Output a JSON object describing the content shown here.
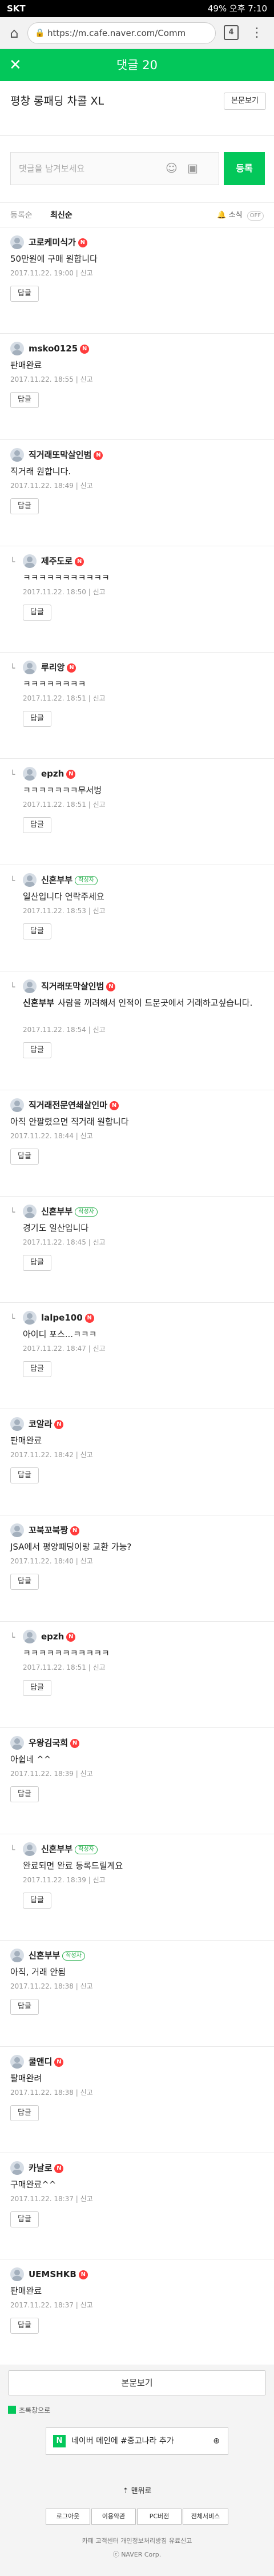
{
  "status_bar": {
    "carrier": "SKT",
    "right": "49% 오후 7:10"
  },
  "browser": {
    "url": "https://m.cafe.naver.com/Comm",
    "tab_count": "4"
  },
  "header": {
    "title": "댓글 20"
  },
  "post": {
    "title": "평창 롱패딩 차콜 XL",
    "view_post": "본문보기"
  },
  "compose": {
    "placeholder": "댓글을 남겨보세요",
    "submit": "등록"
  },
  "sort": {
    "register_order": "등록순",
    "latest": "최신순",
    "notify": "소식",
    "notify_state": "OFF"
  },
  "comments": [
    {
      "author": "고로케미식가",
      "badge": "N",
      "text": "50만원에 구매 원합니다",
      "date": "2017.11.22. 19:00",
      "report": "신고",
      "reply": "답글",
      "is_reply": false
    },
    {
      "author": "msko0125",
      "badge": "N",
      "text": "판매완료",
      "date": "2017.11.22. 18:55",
      "report": "신고",
      "reply": "답글",
      "is_reply": false
    },
    {
      "author": "직거래또막살인범",
      "badge": "N",
      "text": "직거래 원합니다.",
      "date": "2017.11.22. 18:49",
      "report": "신고",
      "reply": "답글",
      "is_reply": false
    },
    {
      "author": "제주도로",
      "badge": "N",
      "text": "ㅋㅋㅋㅋㅋㅋㅋㅋㅋㅋㅋ",
      "date": "2017.11.22. 18:50",
      "report": "신고",
      "reply": "답글",
      "is_reply": true
    },
    {
      "author": "루리앙",
      "badge": "N",
      "text": "ㅋㅋㅋㅋㅋㅋㅋㅋ",
      "date": "2017.11.22. 18:51",
      "report": "신고",
      "reply": "답글",
      "is_reply": true
    },
    {
      "author": "epzh",
      "badge": "N",
      "text": "ㅋㅋㅋㅋㅋㅋㅋ무서벙",
      "date": "2017.11.22. 18:51",
      "report": "신고",
      "reply": "답글",
      "is_reply": true
    },
    {
      "author": "신혼부부",
      "badge": "작성자",
      "text": "일산입니다 연락주세요",
      "date": "2017.11.22. 18:53",
      "report": "신고",
      "reply": "답글",
      "is_reply": true
    },
    {
      "author": "직거래또막살인범",
      "badge": "N",
      "mention": "신혼부부",
      "text": "사람을 꺼려해서 인적이 드문곳에서 거래하고싶습니다.",
      "date": "2017.11.22. 18:54",
      "report": "신고",
      "reply": "답글",
      "is_reply": true
    },
    {
      "author": "직거래전문연쇄살인마",
      "badge": "N",
      "text": "아직 안팔렸으면 직거래 원합니다",
      "date": "2017.11.22. 18:44",
      "report": "신고",
      "reply": "답글",
      "is_reply": false
    },
    {
      "author": "신혼부부",
      "badge": "작성자",
      "text": "경기도 일산입니다",
      "date": "2017.11.22. 18:45",
      "report": "신고",
      "reply": "답글",
      "is_reply": true
    },
    {
      "author": "lalpe100",
      "badge": "N",
      "text": "아이디 포스...ㅋㅋㅋ",
      "date": "2017.11.22. 18:47",
      "report": "신고",
      "reply": "답글",
      "is_reply": true
    },
    {
      "author": "코알라",
      "badge": "N",
      "text": "판매완료",
      "date": "2017.11.22. 18:42",
      "report": "신고",
      "reply": "답글",
      "is_reply": false
    },
    {
      "author": "꼬북꼬북짱",
      "badge": "N",
      "text": "JSA에서 평양패딩이랑 교환 가능?",
      "date": "2017.11.22. 18:40",
      "report": "신고",
      "reply": "답글",
      "is_reply": false
    },
    {
      "author": "epzh",
      "badge": "N",
      "text": "ㅋㅋㅋㅋㅋㅋㅋㅋㅋㅋㅋ",
      "date": "2017.11.22. 18:51",
      "report": "신고",
      "reply": "답글",
      "is_reply": true
    },
    {
      "author": "우왕김국희",
      "badge": "N",
      "text": "아쉽네 ^^",
      "date": "2017.11.22. 18:39",
      "report": "신고",
      "reply": "답글",
      "is_reply": false
    },
    {
      "author": "신혼부부",
      "badge": "작성자",
      "text": "완료되면 완료 등록드릴게요",
      "date": "2017.11.22. 18:39",
      "report": "신고",
      "reply": "답글",
      "is_reply": true
    },
    {
      "author": "신혼부부",
      "badge": "작성자",
      "text": "아직, 거래 안됨",
      "date": "2017.11.22. 18:38",
      "report": "신고",
      "reply": "답글",
      "is_reply": false
    },
    {
      "author": "쿨앤디",
      "badge": "N",
      "text": "팔매완려",
      "date": "2017.11.22. 18:38",
      "report": "신고",
      "reply": "답글",
      "is_reply": false
    },
    {
      "author": "카날로",
      "badge": "N",
      "text": "구매완료^^",
      "date": "2017.11.22. 18:37",
      "report": "신고",
      "reply": "답글",
      "is_reply": false
    },
    {
      "author": "UEMSHKB",
      "badge": "N",
      "text": "판매완료",
      "date": "2017.11.22. 18:37",
      "report": "신고",
      "reply": "답글",
      "is_reply": false
    }
  ],
  "footer": {
    "view_post": "본문보기",
    "green_window": "초록창으로",
    "add_home_n": "N",
    "add_home": "네이버 메인에 #중고나라 추가",
    "top": "맨위로",
    "links": [
      "로그아웃",
      "이용약관",
      "PC버전",
      "전체서비스"
    ],
    "policy": "카페 고객센터    개인정보처리방침    유료신고",
    "copyright": "ⓒ NAVER Corp."
  }
}
